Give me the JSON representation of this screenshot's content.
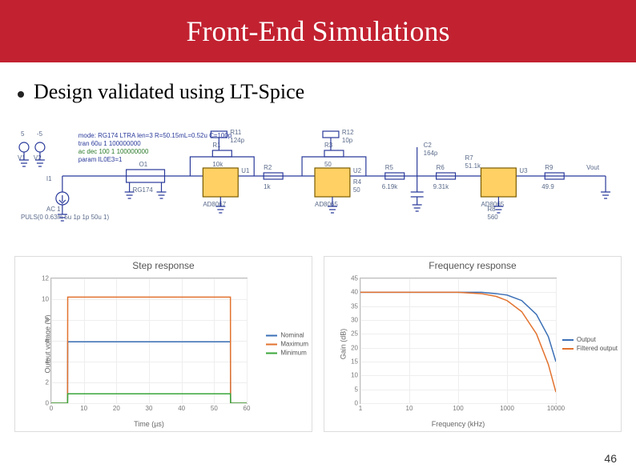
{
  "slide": {
    "title": "Front-End Simulations",
    "bullet": "Design validated using LT-Spice",
    "page_number": "46"
  },
  "schematic": {
    "annotations": {
      "model": "mode: RG174 LTRA len=3 R=50.15mL=0.52u C=100p",
      "tran": "tran 60u 1 100000000",
      "ac": "ac dec 100 1 100000000",
      "param": "param IL0E3=1",
      "source": {
        "name": "I1",
        "ac": "AC 1",
        "value": "PULS(0 0.63m 5u 1p 1p 50u 1)"
      },
      "vplus": "V1",
      "vminus": "V2",
      "tline": {
        "name": "O1",
        "model": "RG174"
      },
      "amp1": {
        "name": "U1",
        "type": "AD8067"
      },
      "amp2": {
        "name": "U2",
        "type": "AD8065"
      },
      "amp3": {
        "name": "U3",
        "type": "AD8065"
      },
      "r1": {
        "name": "R1",
        "value": "10k"
      },
      "r11": {
        "name": "R11",
        "value": "124p"
      },
      "r12": {
        "name": "R12",
        "value": "10p"
      },
      "r2": {
        "name": "R2",
        "value": "1k"
      },
      "r3": {
        "name": "R3",
        "value": "50"
      },
      "r4": {
        "name": "R4",
        "value": "50"
      },
      "r5": {
        "name": "R5",
        "value": "6.19k"
      },
      "c2": {
        "name": "C2",
        "value": "164p"
      },
      "r6": {
        "name": "R6",
        "value": "9.31k"
      },
      "r7": {
        "name": "R7",
        "value": "51.1k"
      },
      "r8": {
        "name": "R8",
        "value": "560"
      },
      "r9": {
        "name": "R9",
        "value": "49.9"
      },
      "vout": "Vout"
    }
  },
  "chart_data": [
    {
      "type": "line",
      "title": "Step response",
      "xlabel": "Time (µs)",
      "ylabel": "Output voltage (V)",
      "xlim": [
        0,
        60
      ],
      "ylim": [
        0,
        12
      ],
      "xticks": [
        0,
        10,
        20,
        30,
        40,
        50,
        60
      ],
      "yticks": [
        0,
        2,
        4,
        6,
        8,
        10,
        12
      ],
      "series": [
        {
          "name": "Nominal",
          "color": "#3b6fb6",
          "x": [
            0,
            5,
            5.05,
            55,
            55.05,
            60
          ],
          "y": [
            0,
            0,
            5.9,
            5.9,
            0,
            0
          ]
        },
        {
          "name": "Maximum",
          "color": "#e2722e",
          "x": [
            0,
            5,
            5.05,
            55,
            55.05,
            60
          ],
          "y": [
            0,
            0,
            10.2,
            10.2,
            0,
            0
          ]
        },
        {
          "name": "Minimum",
          "color": "#3aa63a",
          "x": [
            0,
            5,
            5.05,
            55,
            55.05,
            60
          ],
          "y": [
            0,
            0,
            0.9,
            0.9,
            0,
            0
          ]
        }
      ]
    },
    {
      "type": "line",
      "title": "Frequency response",
      "xlabel": "Frequency (kHz)",
      "ylabel": "Gain (dB)",
      "xlim": [
        1,
        10000
      ],
      "xlog": true,
      "ylim": [
        0,
        45
      ],
      "xticks": [
        1,
        10,
        100,
        1000,
        10000
      ],
      "yticks": [
        0,
        5,
        10,
        15,
        20,
        25,
        30,
        35,
        40,
        45
      ],
      "series": [
        {
          "name": "Output",
          "color": "#3b6fb6",
          "x": [
            1,
            10,
            100,
            300,
            600,
            1000,
            2000,
            4000,
            7000,
            10000
          ],
          "y": [
            40,
            40,
            40,
            40,
            39.5,
            39,
            37,
            32,
            24,
            15
          ]
        },
        {
          "name": "Filtered output",
          "color": "#e2722e",
          "x": [
            1,
            10,
            100,
            300,
            600,
            1000,
            2000,
            4000,
            7000,
            10000
          ],
          "y": [
            40,
            40,
            40,
            39.5,
            38.5,
            37,
            33,
            25,
            14,
            4
          ]
        }
      ]
    }
  ]
}
